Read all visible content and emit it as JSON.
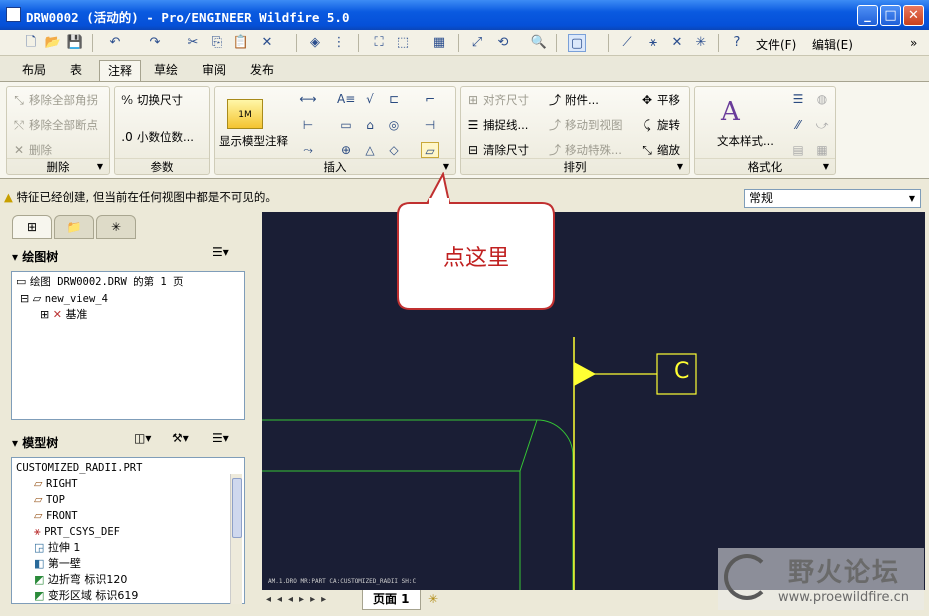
{
  "window": {
    "title": "DRW0002 (活动的) - Pro/ENGINEER Wildfire 5.0"
  },
  "menu": {
    "file": "文件(F)",
    "edit": "编辑(E)",
    "more": "»"
  },
  "tabs": [
    "布局",
    "表",
    "注释",
    "草绘",
    "审阅",
    "发布"
  ],
  "ribbon": {
    "delete_group": {
      "title": "删除",
      "items": [
        "移除全部角拐",
        "移除全部断点",
        "删除"
      ]
    },
    "param_group": {
      "title": "参数",
      "items": [
        "切换尺寸",
        "小数位数..."
      ]
    },
    "insert_group": {
      "title": "插入",
      "show_model": "显示模型注释"
    },
    "arrange_group": {
      "title": "排列",
      "items": [
        "对齐尺寸",
        "附件...",
        "平移",
        "捕捉线...",
        "移动到视图",
        "旋转",
        "清除尺寸",
        "移动特殊...",
        "缩放"
      ]
    },
    "format_group": {
      "title": "格式化",
      "text_style": "文本样式..."
    }
  },
  "status": {
    "message": "特征已经创建, 但当前在任何视图中都是不可见的。",
    "combo_value": "常规"
  },
  "drawing_tree": {
    "title": "绘图树",
    "items": [
      "绘图 DRW0002.DRW 的第 1 页",
      "new_view_4",
      "基准"
    ]
  },
  "model_tree": {
    "title": "模型树",
    "items": [
      "CUSTOMIZED_RADII.PRT",
      "RIGHT",
      "TOP",
      "FRONT",
      "PRT_CSYS_DEF",
      "拉伸 1",
      "第一壁",
      "边折弯 标识120",
      "变形区域 标识619"
    ]
  },
  "callout": {
    "text": "点这里"
  },
  "canvas": {
    "datum_label": "C",
    "footer_text": "AM.1.DRO   MR:PART   CA:CUSTOMIZED_RADII   SH:C"
  },
  "page_tabs": {
    "page_label": "页面 1"
  },
  "watermark": {
    "cn": "野火论坛",
    "url": "www.proewildfire.cn"
  }
}
